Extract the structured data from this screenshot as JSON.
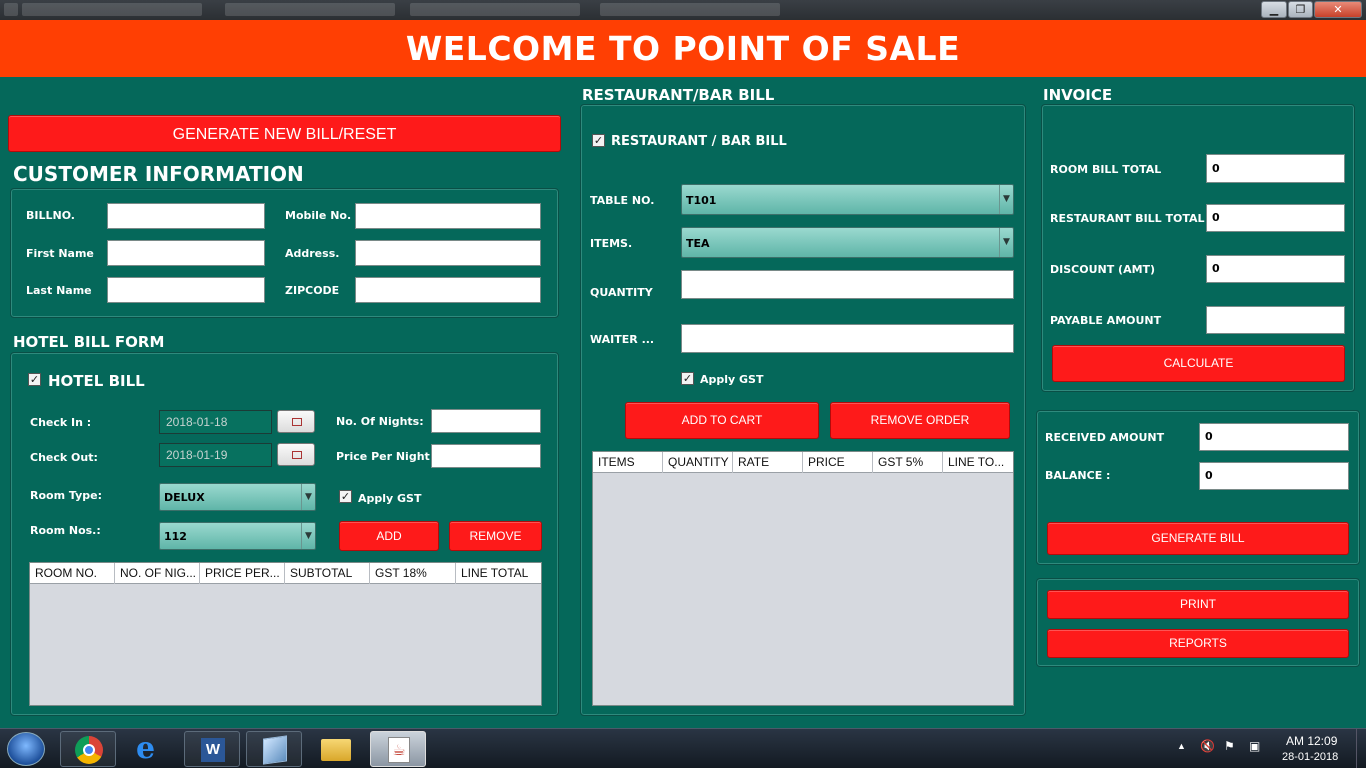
{
  "window": {
    "minimize": "▁",
    "maximize": "❐",
    "close": "✕"
  },
  "header": {
    "title": "WELCOME TO POINT OF SALE"
  },
  "left": {
    "generate_button": "GENERATE NEW BILL/RESET",
    "customer_title": "CUSTOMER INFORMATION",
    "customer": {
      "billno_label": "BILLNO.",
      "mobile_label": "Mobile No.",
      "firstname_label": "First Name",
      "address_label": "Address.",
      "lastname_label": "Last Name",
      "zipcode_label": "ZIPCODE",
      "billno": "",
      "mobile": "",
      "firstname": "",
      "address": "",
      "lastname": "",
      "zipcode": ""
    },
    "hotel_title": "HOTEL BILL FORM",
    "hotel": {
      "checkbox_label": "HOTEL BILL",
      "checkin_label": "Check In :",
      "checkin": "2018-01-18",
      "checkout_label": "Check Out:",
      "checkout": "2018-01-19",
      "nights_label": "No. Of Nights:",
      "nights": "",
      "price_label": "Price Per Night",
      "price": "",
      "roomtype_label": "Room Type:",
      "roomtype": "DELUX",
      "roomnos_label": "Room Nos.:",
      "roomnos": "112",
      "gst_label": "Apply GST",
      "add_button": "ADD",
      "remove_button": "REMOVE",
      "columns": [
        "ROOM NO.",
        "NO. OF NIG...",
        "PRICE PER...",
        "SUBTOTAL",
        "GST 18%",
        "LINE TOTAL"
      ]
    }
  },
  "middle": {
    "title": "RESTAURANT/BAR BILL",
    "checkbox_label": "RESTAURANT / BAR BILL",
    "table_label": "TABLE NO.",
    "table": "T101",
    "items_label": "ITEMS.",
    "items": "TEA",
    "quantity_label": "QUANTITY",
    "quantity": "",
    "waiter_label": "WAITER ...",
    "waiter": "",
    "gst_label": "Apply GST",
    "add_button": "ADD TO CART",
    "remove_button": "REMOVE ORDER",
    "columns": [
      "ITEMS",
      "QUANTITY",
      "RATE",
      "PRICE",
      "GST 5%",
      "LINE TO..."
    ]
  },
  "right": {
    "title": "INVOICE",
    "room_total_label": "ROOM  BILL TOTAL",
    "room_total": "0",
    "rest_total_label": "RESTAURANT BILL TOTAL",
    "rest_total": "0",
    "discount_label": "DISCOUNT (AMT)",
    "discount": "0",
    "payable_label": "PAYABLE AMOUNT",
    "payable": "",
    "calculate_button": "CALCULATE",
    "received_label": "RECEIVED AMOUNT",
    "received": "0",
    "balance_label": "BALANCE :",
    "balance": "0",
    "generate_bill_button": "GENERATE BILL",
    "print_button": "PRINT",
    "reports_button": "REPORTS"
  },
  "taskbar": {
    "time": "AM 12:09",
    "date": "28-01-2018",
    "apps": [
      "start-icon",
      "chrome-icon",
      "ie-icon",
      "word-icon",
      "virtualbox-icon",
      "folder-icon",
      "java-icon"
    ]
  }
}
